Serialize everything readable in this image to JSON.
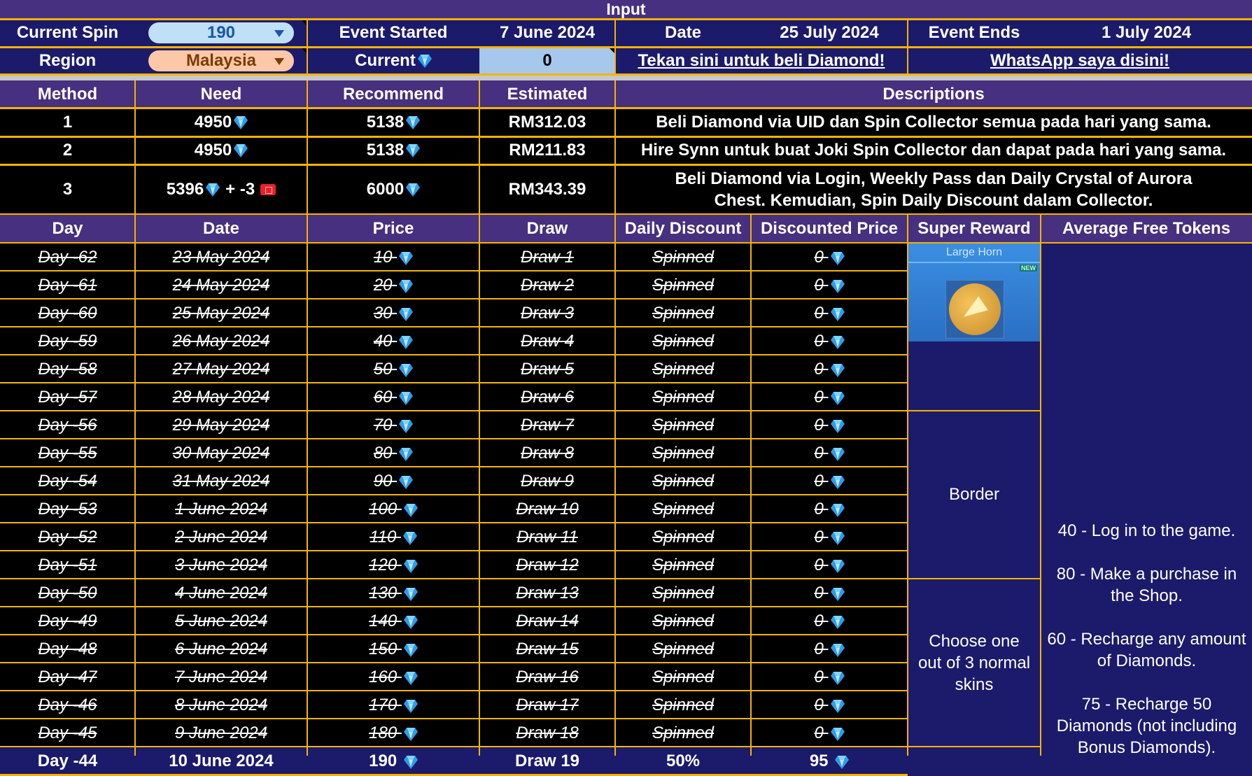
{
  "input_title": "Input",
  "top": {
    "current_spin_label": "Current Spin",
    "current_spin_value": "190",
    "region_label": "Region",
    "region_value": "Malaysia",
    "event_started_label": "Event Started",
    "event_started_value": "7 June 2024",
    "current_label": "Current",
    "current_value": "0",
    "date_label": "Date",
    "date_value": "25 July 2024",
    "event_ends_label": "Event Ends",
    "event_ends_value": "1 July 2024",
    "buy_link": "Tekan sini untuk beli Diamond!",
    "whatsapp_link": "WhatsApp saya disini!"
  },
  "methods": {
    "headers": [
      "Method",
      "Need",
      "Recommend",
      "Estimated",
      "Descriptions"
    ],
    "rows": [
      {
        "method": "1",
        "need": "4950",
        "need_extra": "",
        "recommend": "5138",
        "estimated": "RM312.03",
        "description": "Beli Diamond via UID dan Spin Collector semua pada hari yang sama."
      },
      {
        "method": "2",
        "need": "4950",
        "need_extra": "",
        "recommend": "5138",
        "estimated": "RM211.83",
        "description": "Hire Synn untuk buat Joki Spin Collector dan dapat pada hari yang sama."
      },
      {
        "method": "3",
        "need": "5396",
        "need_extra": "+ -3",
        "recommend": "6000",
        "estimated": "RM343.39",
        "description": "Beli Diamond via Login, Weekly Pass dan Daily Crystal of Aurora Chest. Kemudian, Spin Daily Discount dalam Collector."
      }
    ]
  },
  "days": {
    "headers": [
      "Day",
      "Date",
      "Price",
      "Draw",
      "Daily Discount",
      "Discounted Price",
      "Super Reward",
      "Average Free Tokens"
    ],
    "rows": [
      {
        "day": "Day -62",
        "date": "23 May 2024",
        "price": "10",
        "draw": "Draw 1",
        "discount": "Spinned",
        "discounted": "0",
        "done": true
      },
      {
        "day": "Day -61",
        "date": "24 May 2024",
        "price": "20",
        "draw": "Draw 2",
        "discount": "Spinned",
        "discounted": "0",
        "done": true
      },
      {
        "day": "Day -60",
        "date": "25 May 2024",
        "price": "30",
        "draw": "Draw 3",
        "discount": "Spinned",
        "discounted": "0",
        "done": true
      },
      {
        "day": "Day -59",
        "date": "26 May 2024",
        "price": "40",
        "draw": "Draw 4",
        "discount": "Spinned",
        "discounted": "0",
        "done": true
      },
      {
        "day": "Day -58",
        "date": "27 May 2024",
        "price": "50",
        "draw": "Draw 5",
        "discount": "Spinned",
        "discounted": "0",
        "done": true
      },
      {
        "day": "Day -57",
        "date": "28 May 2024",
        "price": "60",
        "draw": "Draw 6",
        "discount": "Spinned",
        "discounted": "0",
        "done": true
      },
      {
        "day": "Day -56",
        "date": "29 May 2024",
        "price": "70",
        "draw": "Draw 7",
        "discount": "Spinned",
        "discounted": "0",
        "done": true
      },
      {
        "day": "Day -55",
        "date": "30 May 2024",
        "price": "80",
        "draw": "Draw 8",
        "discount": "Spinned",
        "discounted": "0",
        "done": true
      },
      {
        "day": "Day -54",
        "date": "31 May 2024",
        "price": "90",
        "draw": "Draw 9",
        "discount": "Spinned",
        "discounted": "0",
        "done": true
      },
      {
        "day": "Day -53",
        "date": "1 June 2024",
        "price": "100",
        "draw": "Draw 10",
        "discount": "Spinned",
        "discounted": "0",
        "done": true
      },
      {
        "day": "Day -52",
        "date": "2 June 2024",
        "price": "110",
        "draw": "Draw 11",
        "discount": "Spinned",
        "discounted": "0",
        "done": true
      },
      {
        "day": "Day -51",
        "date": "3 June 2024",
        "price": "120",
        "draw": "Draw 12",
        "discount": "Spinned",
        "discounted": "0",
        "done": true
      },
      {
        "day": "Day -50",
        "date": "4 June 2024",
        "price": "130",
        "draw": "Draw 13",
        "discount": "Spinned",
        "discounted": "0",
        "done": true
      },
      {
        "day": "Day -49",
        "date": "5 June 2024",
        "price": "140",
        "draw": "Draw 14",
        "discount": "Spinned",
        "discounted": "0",
        "done": true
      },
      {
        "day": "Day -48",
        "date": "6 June 2024",
        "price": "150",
        "draw": "Draw 15",
        "discount": "Spinned",
        "discounted": "0",
        "done": true
      },
      {
        "day": "Day -47",
        "date": "7 June 2024",
        "price": "160",
        "draw": "Draw 16",
        "discount": "Spinned",
        "discounted": "0",
        "done": true
      },
      {
        "day": "Day -46",
        "date": "8 June 2024",
        "price": "170",
        "draw": "Draw 17",
        "discount": "Spinned",
        "discounted": "0",
        "done": true
      },
      {
        "day": "Day -45",
        "date": "9 June 2024",
        "price": "180",
        "draw": "Draw 18",
        "discount": "Spinned",
        "discounted": "0",
        "done": true
      },
      {
        "day": "Day -44",
        "date": "10 June 2024",
        "price": "190",
        "draw": "Draw 19",
        "discount": "50%",
        "discounted": "95",
        "done": false
      }
    ]
  },
  "super_rewards": {
    "item1_name": "Large Horn",
    "item1_badge": "NEW",
    "item2": "Border",
    "item3": "Choose one out of 3 normal skins"
  },
  "free_tokens": [
    "40 - Log in to the game.",
    "80 - Make a purchase in the Shop.",
    "60 - Recharge any amount of Diamonds.",
    "75 - Recharge 50 Diamonds (not including Bonus Diamonds)."
  ],
  "colors": {
    "navy": "#1c1a6b",
    "purple_header": "#46307f",
    "grid_gold": "#f5b400",
    "spin_pill": "#bfe0f7",
    "region_pill": "#fcc8a8",
    "current_cell": "#a6c8ec"
  }
}
